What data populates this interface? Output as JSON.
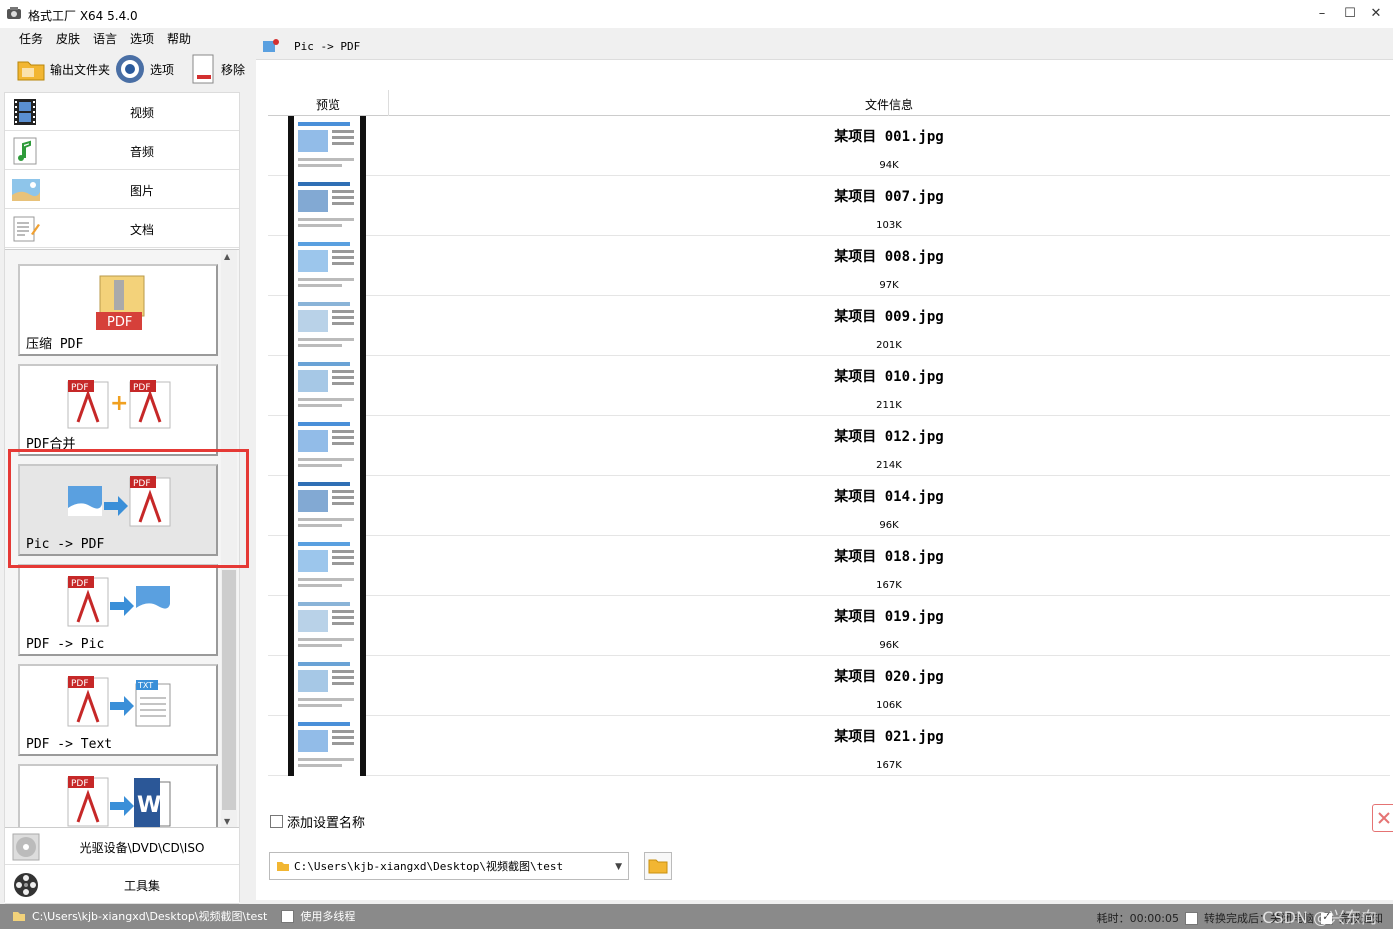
{
  "window": {
    "title": "格式工厂 X64 5.4.0",
    "minimize": "–",
    "maximize": "☐",
    "close": "✕"
  },
  "menu": [
    "任务",
    "皮肤",
    "语言",
    "选项",
    "帮助"
  ],
  "toolbar": {
    "output_folder": "输出文件夹",
    "options": "选项",
    "remove": "移除"
  },
  "categories": [
    {
      "label": "视频",
      "icon": "film-icon"
    },
    {
      "label": "音频",
      "icon": "music-note-icon"
    },
    {
      "label": "图片",
      "icon": "picture-icon"
    },
    {
      "label": "文档",
      "icon": "document-icon"
    }
  ],
  "functions": [
    {
      "label": "压缩 PDF",
      "icon": "compress-pdf-icon"
    },
    {
      "label": "PDF合并",
      "icon": "pdf-merge-icon"
    },
    {
      "label": "Pic -> PDF",
      "icon": "pic-to-pdf-icon"
    },
    {
      "label": "PDF -> Pic",
      "icon": "pdf-to-pic-icon"
    },
    {
      "label": "PDF -> Text",
      "icon": "pdf-to-text-icon"
    },
    {
      "label": "",
      "icon": "pdf-to-word-icon"
    }
  ],
  "bottom_categories": [
    {
      "label": "光驱设备\\DVD\\CD\\ISO",
      "icon": "disc-icon"
    },
    {
      "label": "工具集",
      "icon": "film-reel-icon"
    }
  ],
  "right_panel": {
    "title": "Pic -> PDF",
    "columns": {
      "preview": "预览",
      "file_info": "文件信息"
    },
    "files": [
      {
        "name": "某项目 001.jpg",
        "size": "94K"
      },
      {
        "name": "某项目 007.jpg",
        "size": "103K"
      },
      {
        "name": "某项目 008.jpg",
        "size": "97K"
      },
      {
        "name": "某项目 009.jpg",
        "size": "201K"
      },
      {
        "name": "某项目 010.jpg",
        "size": "211K"
      },
      {
        "name": "某项目 012.jpg",
        "size": "214K"
      },
      {
        "name": "某项目 014.jpg",
        "size": "96K"
      },
      {
        "name": "某项目 018.jpg",
        "size": "167K"
      },
      {
        "name": "某项目 019.jpg",
        "size": "96K"
      },
      {
        "name": "某项目 020.jpg",
        "size": "106K"
      },
      {
        "name": "某项目 021.jpg",
        "size": "167K"
      }
    ],
    "add_setting_name": "添加设置名称",
    "output_path": "C:\\Users\\kjb-xiangxd\\Desktop\\视频截图\\test"
  },
  "status": {
    "path": "C:\\Users\\kjb-xiangxd\\Desktop\\视频截图\\test",
    "multithread": "使用多线程",
    "elapsed": "耗时：00:00:05",
    "after_convert": "转换完成后：关闭电脑",
    "notify": "完成通知",
    "watermark": "CSDN @兴东向"
  },
  "colors": {
    "highlight": "#e53935",
    "pdf_red": "#c62828",
    "accent_blue": "#3a8fd8"
  }
}
